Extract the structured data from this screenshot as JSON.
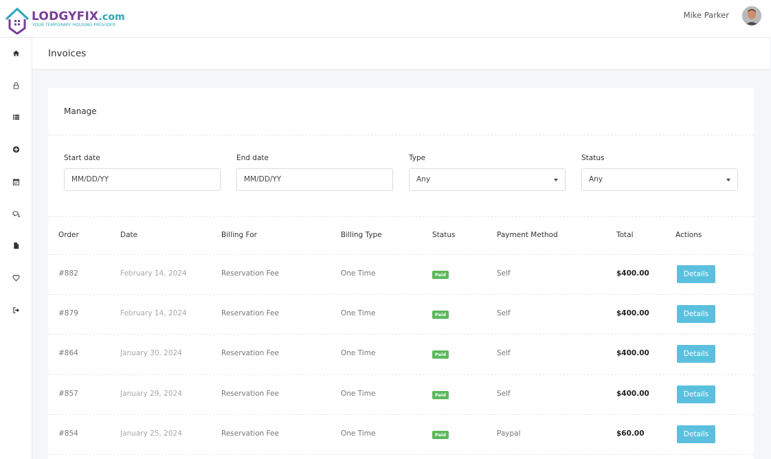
{
  "brand": {
    "name": "LODGYFIX",
    "domain_suffix": ".com",
    "tagline": "YOUR TEMPORARY HOUSING PROVIDER"
  },
  "user": {
    "name": "Mike Parker"
  },
  "sidebar": {
    "items": [
      {
        "icon": "home-icon"
      },
      {
        "icon": "lock-icon"
      },
      {
        "icon": "list-icon"
      },
      {
        "icon": "plus-circle-icon"
      },
      {
        "icon": "calendar-icon"
      },
      {
        "icon": "chat-icon"
      },
      {
        "icon": "file-icon"
      },
      {
        "icon": "heart-icon"
      },
      {
        "icon": "sign-out-icon"
      }
    ]
  },
  "page": {
    "title": "Invoices"
  },
  "manage": {
    "title": "Manage",
    "filters": {
      "start_date": {
        "label": "Start date",
        "placeholder": "MM/DD/YY"
      },
      "end_date": {
        "label": "End date",
        "placeholder": "MM/DD/YY"
      },
      "type": {
        "label": "Type",
        "value": "Any"
      },
      "status": {
        "label": "Status",
        "value": "Any"
      }
    }
  },
  "table": {
    "headers": {
      "order": "Order",
      "date": "Date",
      "billing_for": "Billing For",
      "billing_type": "Billing Type",
      "status": "Status",
      "payment_method": "Payment Method",
      "total": "Total",
      "actions": "Actions"
    },
    "rows": [
      {
        "order": "#882",
        "date": "February 14, 2024",
        "billing_for": "Reservation Fee",
        "billing_type": "One Time",
        "status": "Paid",
        "payment_method": "Self",
        "total": "$400.00",
        "action": "Details"
      },
      {
        "order": "#879",
        "date": "February 14, 2024",
        "billing_for": "Reservation Fee",
        "billing_type": "One Time",
        "status": "Paid",
        "payment_method": "Self",
        "total": "$400.00",
        "action": "Details"
      },
      {
        "order": "#864",
        "date": "January 30, 2024",
        "billing_for": "Reservation Fee",
        "billing_type": "One Time",
        "status": "Paid",
        "payment_method": "Self",
        "total": "$400.00",
        "action": "Details"
      },
      {
        "order": "#857",
        "date": "January 29, 2024",
        "billing_for": "Reservation Fee",
        "billing_type": "One Time",
        "status": "Paid",
        "payment_method": "Self",
        "total": "$400.00",
        "action": "Details"
      },
      {
        "order": "#854",
        "date": "January 25, 2024",
        "billing_for": "Reservation Fee",
        "billing_type": "One Time",
        "status": "Paid",
        "payment_method": "Paypal",
        "total": "$60.00",
        "action": "Details"
      }
    ]
  },
  "colors": {
    "brand_purple": "#7a3d9c",
    "brand_teal": "#2aa9b8",
    "paid_badge": "#5cb85c",
    "details_button": "#5bc0de"
  }
}
